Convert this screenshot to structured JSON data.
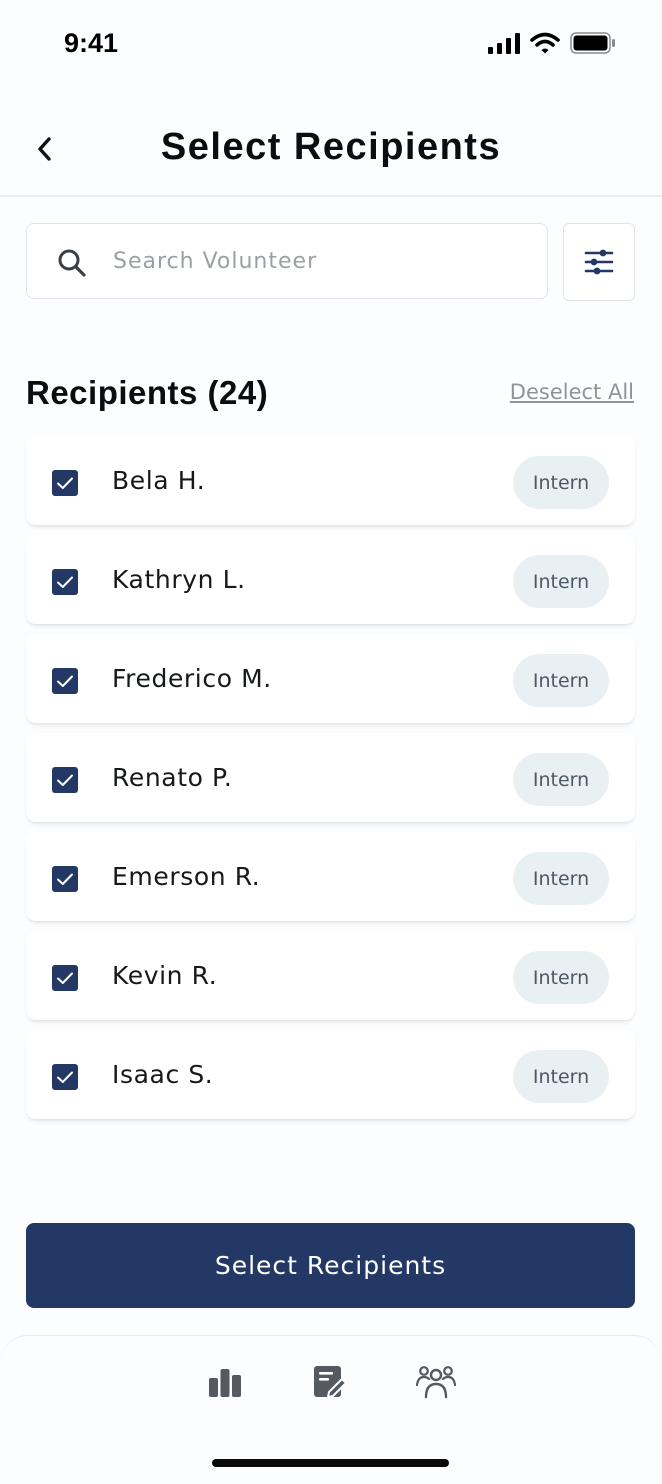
{
  "status_bar": {
    "time": "9:41"
  },
  "header": {
    "title": "Select Recipients"
  },
  "search": {
    "placeholder": "Search Volunteer",
    "value": ""
  },
  "section": {
    "title": "Recipients (24)",
    "deselect_label": "Deselect All"
  },
  "recipients": [
    {
      "name": "Bela H.",
      "role": "Intern",
      "checked": true
    },
    {
      "name": "Kathryn L.",
      "role": "Intern",
      "checked": true
    },
    {
      "name": "Frederico M.",
      "role": "Intern",
      "checked": true
    },
    {
      "name": "Renato P.",
      "role": "Intern",
      "checked": true
    },
    {
      "name": "Emerson R.",
      "role": "Intern",
      "checked": true
    },
    {
      "name": "Kevin R.",
      "role": "Intern",
      "checked": true
    },
    {
      "name": "Isaac S.",
      "role": "Intern",
      "checked": true
    }
  ],
  "primary_button": {
    "label": "Select Recipients"
  },
  "tab_bar": {
    "items": [
      {
        "icon": "bar-chart-icon"
      },
      {
        "icon": "edit-note-icon"
      },
      {
        "icon": "people-group-icon"
      }
    ]
  },
  "colors": {
    "primary": "#233864",
    "badge_bg": "#e9f0f3",
    "badge_text": "#4b5965",
    "placeholder": "#9aa0a6"
  }
}
